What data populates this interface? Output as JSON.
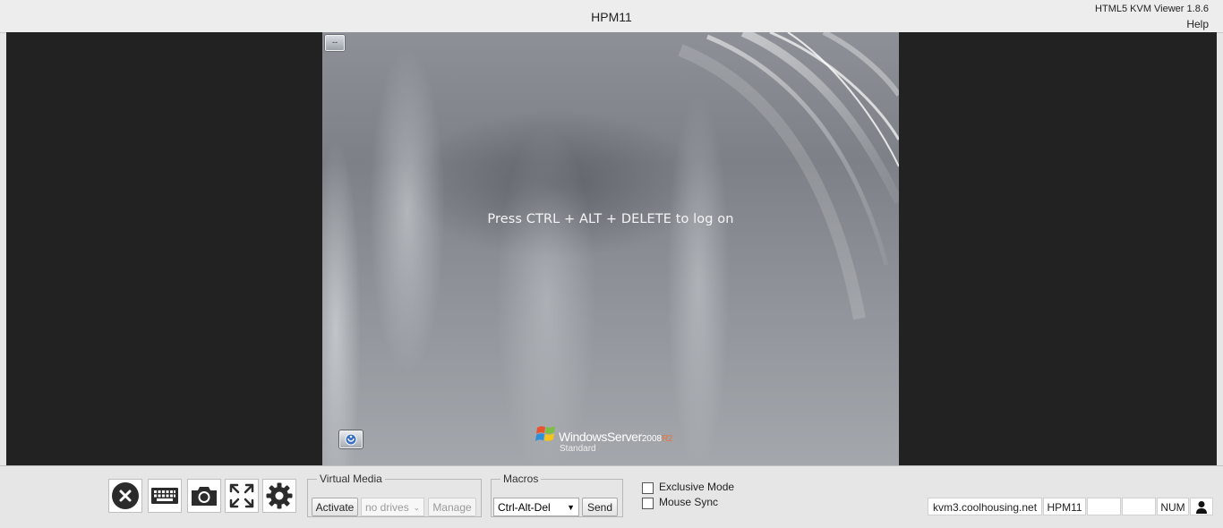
{
  "header": {
    "title": "HPM11",
    "version": "HTML5 KVM Viewer 1.8.6",
    "help_label": "Help"
  },
  "remote_screen": {
    "logon_message": "Press CTRL + ALT + DELETE to log on",
    "minimize_glyph": "--",
    "brand": {
      "name": "WindowsServer",
      "year": "2008",
      "release": "R2",
      "edition": "Standard"
    },
    "icons": [
      "windows-flag-icon",
      "ease-of-access-icon"
    ]
  },
  "toolbar": {
    "buttons": [
      {
        "name": "disconnect",
        "icon": "close-circle-icon"
      },
      {
        "name": "virtual-keyboard",
        "icon": "keyboard-icon"
      },
      {
        "name": "screenshot",
        "icon": "camera-icon"
      },
      {
        "name": "fullscreen",
        "icon": "expand-arrows-icon"
      },
      {
        "name": "settings",
        "icon": "gear-icon"
      }
    ]
  },
  "virtual_media": {
    "legend": "Virtual Media",
    "activate_label": "Activate",
    "drives_value": "no drives",
    "manage_label": "Manage"
  },
  "macros": {
    "legend": "Macros",
    "selected": "Ctrl-Alt-Del",
    "send_label": "Send"
  },
  "options": {
    "exclusive_mode_label": "Exclusive Mode",
    "exclusive_mode_checked": false,
    "mouse_sync_label": "Mouse Sync",
    "mouse_sync_checked": false
  },
  "status": {
    "host": "kvm3.coolhousing.net",
    "server": "HPM11",
    "indicator1": "",
    "indicator2": "",
    "num_lock": "NUM",
    "user_icon": "user-icon"
  },
  "colors": {
    "viewport_bg": "#222222",
    "toolbar_bg": "#e6e6e6",
    "r2_accent": "#e8743b"
  }
}
